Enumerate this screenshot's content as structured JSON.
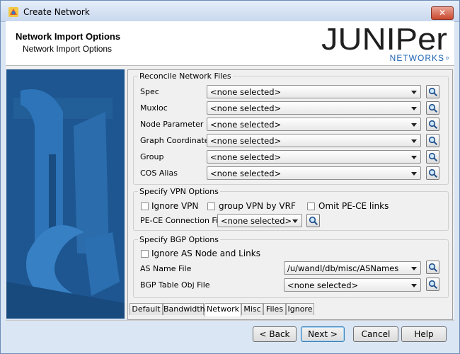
{
  "window": {
    "title": "Create Network",
    "close_glyph": "✕"
  },
  "header": {
    "title": "Network Import Options",
    "subtitle": "Network Import Options",
    "logo_word": "JUNIPer",
    "logo_sub": "NETWORKS",
    "logo_color": "#1f1f1f",
    "logo_sub_color": "#1e64b4"
  },
  "reconcile": {
    "legend": "Reconcile Network Files",
    "rows": [
      {
        "label": "Spec",
        "value": "<none selected>"
      },
      {
        "label": "Muxloc",
        "value": "<none selected>"
      },
      {
        "label": "Node Parameter",
        "value": "<none selected>"
      },
      {
        "label": "Graph Coordinates",
        "value": "<none selected>"
      },
      {
        "label": "Group",
        "value": "<none selected>"
      },
      {
        "label": "COS Alias",
        "value": "<none selected>"
      }
    ]
  },
  "vpn": {
    "legend": "Specify VPN Options",
    "ignore_vpn": "Ignore VPN",
    "group_vpn": "group VPN by VRF",
    "omit_pece": "Omit PE-CE links",
    "pece_label": "PE-CE Connection File",
    "pece_value": "<none selected>"
  },
  "bgp": {
    "legend": "Specify BGP Options",
    "ignore_as": "Ignore AS Node and Links",
    "as_label": "AS Name File",
    "as_value": "/u/wandl/db/misc/ASNames",
    "table_label": "BGP Table Obj File",
    "table_value": "<none selected>"
  },
  "tabs": [
    "Default",
    "Bandwidth",
    "Network",
    "Misc",
    "Files",
    "Ignore"
  ],
  "active_tab": "Network",
  "buttons": {
    "back": "< Back",
    "next": "Next >",
    "cancel": "Cancel",
    "help": "Help"
  },
  "icons": {
    "search": "search-icon",
    "close": "close-icon",
    "arrow": "chevron-down-icon"
  },
  "colors": {
    "panel_blue": "#1e5691",
    "accent": "#3c7fb1"
  }
}
